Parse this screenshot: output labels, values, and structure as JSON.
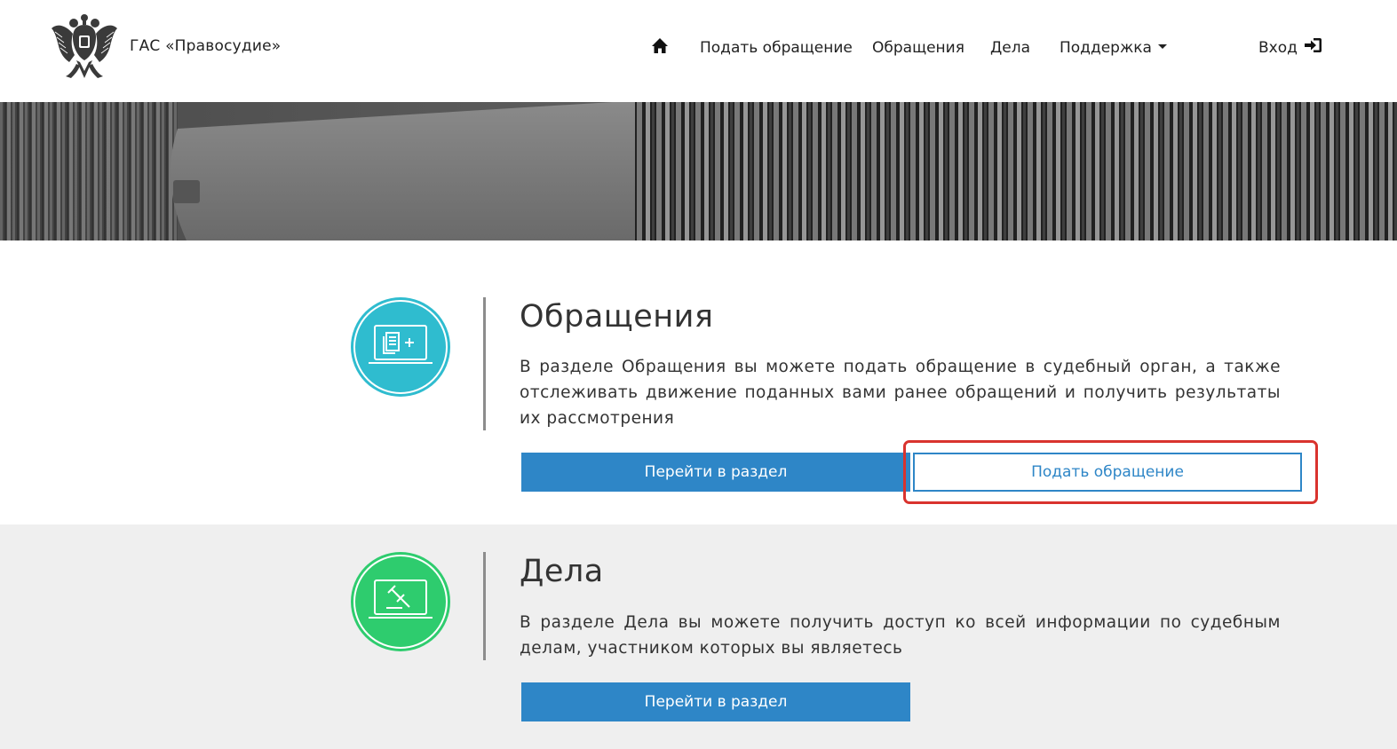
{
  "header": {
    "brand": "ГАС «Правосудие»",
    "nav": {
      "home_icon": "home-icon",
      "items": [
        "Подать обращение",
        "Обращения",
        "Дела",
        "Поддержка"
      ],
      "login": "Вход",
      "login_icon": "sign-in-icon"
    }
  },
  "sections": {
    "appeals": {
      "icon": "laptop-document-plus-icon",
      "icon_color": "#2fbccf",
      "title": "Обращения",
      "text": "В разделе Обращения вы можете подать обращение в судебный орган, а также отслеживать движение поданных вами ранее обращений и получить результаты их рассмотрения",
      "goto_button": "Перейти в раздел",
      "submit_button": "Подать обращение"
    },
    "cases": {
      "icon": "laptop-gavel-icon",
      "icon_color": "#2ecc6e",
      "title": "Дела",
      "text": "В разделе Дела вы можете получить доступ ко всей информации по судебным делам, участником которых вы являетесь",
      "goto_button": "Перейти в раздел"
    }
  },
  "colors": {
    "primary": "#2e86c7",
    "highlight": "#d9332e",
    "section_alt_bg": "#efefef"
  }
}
